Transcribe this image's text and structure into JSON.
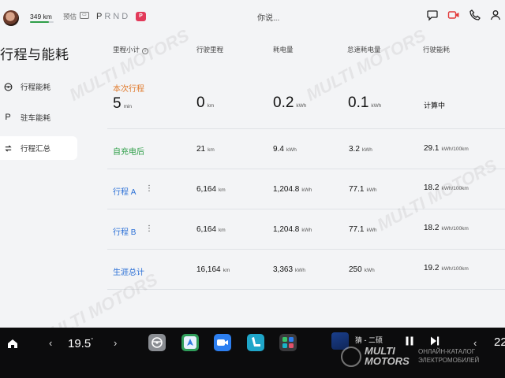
{
  "status_bar": {
    "range": "349 km",
    "range_fraction": 0.8,
    "preset": "预估",
    "gears": [
      "P",
      "R",
      "N",
      "D"
    ],
    "active_gear": "P",
    "park_badge": "P",
    "voice_prompt": "你说...",
    "icons": [
      "chat-icon",
      "camera-record-icon",
      "phone-icon",
      "user-icon"
    ]
  },
  "page_title": "行程与能耗",
  "sidebar": {
    "items": [
      {
        "label": "行程能耗",
        "icon": "steering-wheel-icon",
        "active": false
      },
      {
        "label": "驻车能耗",
        "icon": "parking-p-icon",
        "active": false
      },
      {
        "label": "行程汇总",
        "icon": "swap-arrows-icon",
        "active": true
      }
    ]
  },
  "table": {
    "columns": [
      "里程小计",
      "行驶里程",
      "耗电量",
      "怠速耗电量",
      "行驶能耗"
    ],
    "rows": [
      {
        "label": "本次行程",
        "label_sub": "5",
        "label_sub_unit": "min",
        "label_color": "#e07a2c",
        "has_menu": false,
        "distance": {
          "value": "0",
          "unit": "km"
        },
        "energy": {
          "value": "0.2",
          "unit": "kWh"
        },
        "idle_energy": {
          "value": "0.1",
          "unit": "kWh"
        },
        "consumption": {
          "value": "计算中",
          "unit": ""
        }
      },
      {
        "label": "自充电后",
        "label_color": "#2e9e48",
        "has_menu": false,
        "distance": {
          "value": "21",
          "unit": "km"
        },
        "energy": {
          "value": "9.4",
          "unit": "kWh"
        },
        "idle_energy": {
          "value": "3.2",
          "unit": "kWh"
        },
        "consumption": {
          "value": "29.1",
          "unit": "kWh/100km"
        }
      },
      {
        "label": "行程 A",
        "label_color": "#2a6fd6",
        "has_menu": true,
        "distance": {
          "value": "6,164",
          "unit": "km"
        },
        "energy": {
          "value": "1,204.8",
          "unit": "kWh"
        },
        "idle_energy": {
          "value": "77.1",
          "unit": "kWh"
        },
        "consumption": {
          "value": "18.2",
          "unit": "kWh/100km"
        }
      },
      {
        "label": "行程 B",
        "label_color": "#2a6fd6",
        "has_menu": true,
        "distance": {
          "value": "6,164",
          "unit": "km"
        },
        "energy": {
          "value": "1,204.8",
          "unit": "kWh"
        },
        "idle_energy": {
          "value": "77.1",
          "unit": "kWh"
        },
        "consumption": {
          "value": "18.2",
          "unit": "kWh/100km"
        }
      },
      {
        "label": "生涯总计",
        "label_color": "#2a6fd6",
        "has_menu": false,
        "distance": {
          "value": "16,164",
          "unit": "km"
        },
        "energy": {
          "value": "3,363",
          "unit": "kWh"
        },
        "idle_energy": {
          "value": "250",
          "unit": "kWh"
        },
        "consumption": {
          "value": "19.2",
          "unit": "kWh/100km"
        }
      }
    ]
  },
  "dock": {
    "home_icon": "home-icon",
    "driver_temp": "19.5",
    "driver_temp_unit": "°",
    "passenger_temp": "22",
    "apps": [
      {
        "name": "steering-app-icon",
        "color": "#8a8d92"
      },
      {
        "name": "navigation-app-icon",
        "color": "#2f9d5a"
      },
      {
        "name": "video-call-app-icon",
        "color": "#2d7ff0"
      },
      {
        "name": "seat-app-icon",
        "color": "#1fa6c9"
      },
      {
        "name": "multi-app-icon",
        "color": "#3a3a3d"
      }
    ],
    "song": "猜 - 二硕",
    "media_controls": [
      "pause-icon",
      "next-icon"
    ]
  },
  "watermark": {
    "brand_line1": "MULTI",
    "brand_line2": "MOTORS",
    "sub_line1": "ОНЛАЙН-КАТАЛОГ",
    "sub_line2": "ЭЛЕКТРОМОБИЛЕЙ"
  }
}
